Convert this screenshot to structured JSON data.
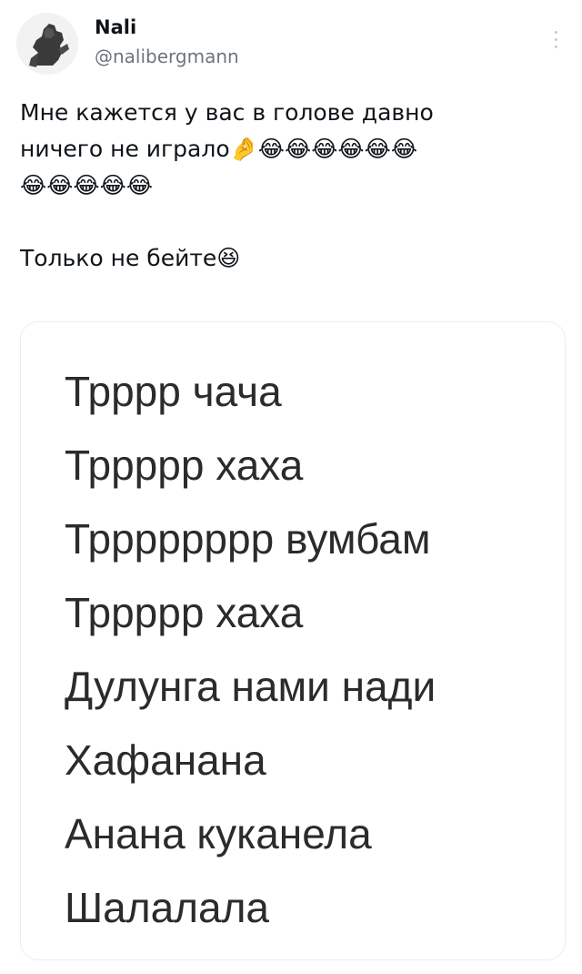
{
  "tweet": {
    "author": {
      "display_name": "Nali",
      "handle": "@nalibergmann",
      "avatar_icon": "statue-avatar-icon"
    },
    "more_icon": "more-vertical-icon",
    "text_line_1": "Мне кажется у вас в голове давно",
    "text_line_2_prefix": "ничего не играло",
    "text_line_2_emoji": "🤌😂😂😂😂😂😂",
    "text_line_3_emoji": "😂😂😂😂😂",
    "text_line_4_prefix": "Только не бейте",
    "text_line_4_emoji": "😆"
  },
  "media": {
    "lines": [
      "Трррр чача",
      "Тррррр хаха",
      "Трррррррр вумбам",
      "Тррррр хаха",
      "Дулунга нами нади",
      "Хафанана",
      "Анана куканела",
      "Шалалала"
    ]
  },
  "colors": {
    "text": "#0f1419",
    "secondary_text": "#6b7580",
    "card_border": "#eaedf0",
    "lyrics_text": "#2b2b2b"
  }
}
